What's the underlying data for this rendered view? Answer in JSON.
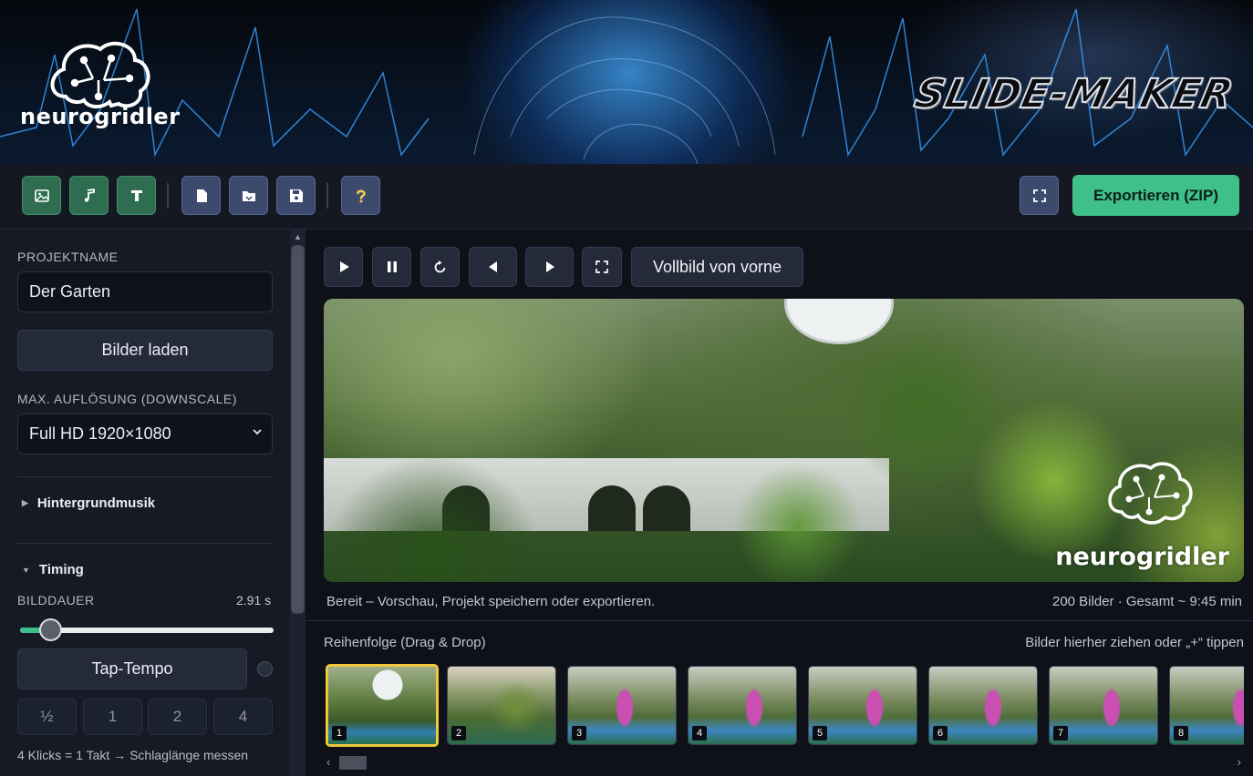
{
  "banner": {
    "brand": "neurogridler",
    "app_title": "SLIDE-MAKER"
  },
  "toolbar": {
    "buttons": [
      {
        "name": "add-image-button",
        "icon": "image-icon",
        "color": "#2e6d4f"
      },
      {
        "name": "add-music-button",
        "icon": "music-note-icon",
        "color": "#2e6d4f"
      },
      {
        "name": "add-text-button",
        "icon": "text-t-icon",
        "color": "#2e6d4f"
      },
      {
        "name": "new-project-button",
        "icon": "file-icon",
        "color": "#3c4a6e"
      },
      {
        "name": "open-project-button",
        "icon": "folder-icon",
        "color": "#3c4a6e"
      },
      {
        "name": "save-project-button",
        "icon": "floppy-disk-icon",
        "color": "#3c4a6e"
      },
      {
        "name": "help-button",
        "icon": "question-mark-icon",
        "color": "#3c4a6e"
      }
    ],
    "fullscreen_icon": "fullscreen-icon",
    "export_label": "Exportieren (ZIP)",
    "accent": "#3fbf8a"
  },
  "sidebar": {
    "project_label": "PROJEKTNAME",
    "project_value": "Der Garten",
    "load_images_label": "Bilder laden",
    "resolution_label": "MAX. AUFLÖSUNG (DOWNSCALE)",
    "resolution_value": "Full HD 1920×1080",
    "music_section": "Hintergrundmusik",
    "timing_section": "Timing",
    "duration_label": "BILDDAUER",
    "duration_value": "2.91 s",
    "duration_fraction": 0.12,
    "tap_tempo_label": "Tap-Tempo",
    "multipliers": [
      "½",
      "1",
      "2",
      "4"
    ],
    "hint": "4 Klicks = 1 Takt → Schlaglänge messen"
  },
  "player": {
    "controls": [
      {
        "name": "play-button",
        "icon": "play-icon"
      },
      {
        "name": "pause-button",
        "icon": "pause-icon"
      },
      {
        "name": "restart-button",
        "icon": "rotate-icon"
      },
      {
        "name": "previous-button",
        "icon": "triangle-left-icon"
      },
      {
        "name": "next-button",
        "icon": "triangle-right-icon"
      },
      {
        "name": "fullscreen-preview-button",
        "icon": "fullscreen-icon"
      }
    ],
    "fullscreen_from_start": "Vollbild von vorne",
    "watermark": "neurogridler",
    "status": "Bereit – Vorschau, Projekt speichern oder exportieren.",
    "count": "200 Bilder · Gesamt ~ 9:45 min"
  },
  "timeline": {
    "title": "Reihenfolge (Drag & Drop)",
    "hint": "Bilder hierher ziehen oder „+“ tippen",
    "thumbs": [
      "1",
      "2",
      "3",
      "4",
      "5",
      "6",
      "7",
      "8"
    ],
    "selected_index": 0,
    "selected_color": "#f0c93a"
  }
}
